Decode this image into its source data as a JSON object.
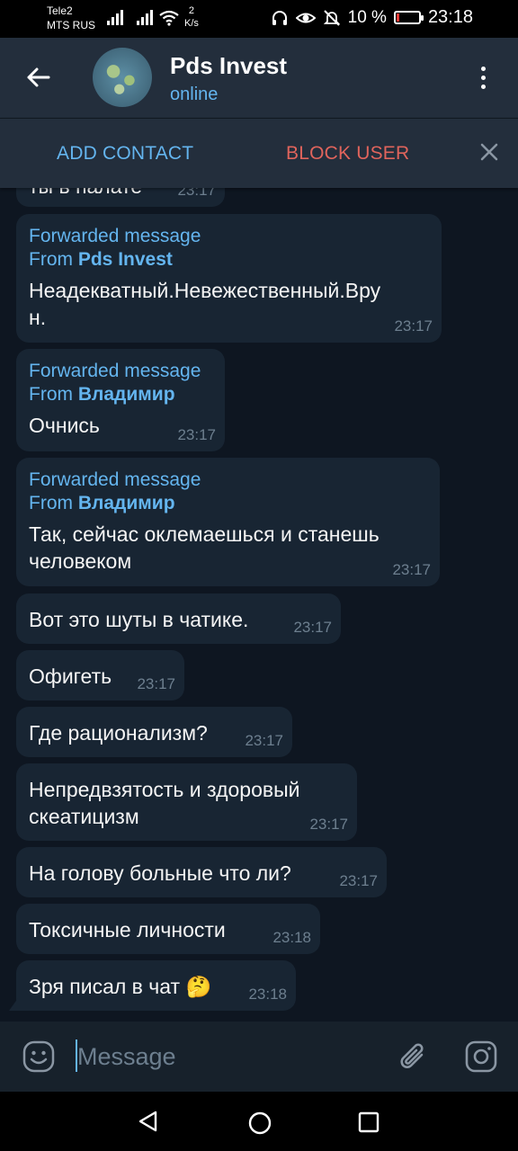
{
  "status_bar": {
    "carrier1": "Tele2",
    "carrier2": "MTS RUS",
    "speed_value": "2",
    "speed_unit": "K/s",
    "battery": "10 %",
    "battery_level": 0.1,
    "time": "23:18",
    "icons": [
      "headphones-icon",
      "eye-icon",
      "silent-icon",
      "battery-icon"
    ]
  },
  "header": {
    "back_icon": "arrow-left-icon",
    "title": "Pds Invest",
    "status": "online",
    "menu_icon": "more-vertical-icon"
  },
  "action_bar": {
    "add_contact": "ADD CONTACT",
    "block_user": "BLOCK USER",
    "close_icon": "close-icon"
  },
  "messages": [
    {
      "text": "ты в палате",
      "time": "23:17"
    },
    {
      "fwd_label": "Forwarded message",
      "fwd_from_prefix": "From",
      "fwd_from_name": "Pds Invest",
      "text": "Неадекватный.Невежественный.Вру",
      "text2": "н.",
      "time": "23:17"
    },
    {
      "fwd_label": "Forwarded message",
      "fwd_from_prefix": "From",
      "fwd_from_name": "Владимир",
      "text": "Очнись",
      "time": "23:17"
    },
    {
      "fwd_label": "Forwarded message",
      "fwd_from_prefix": "From",
      "fwd_from_name": "Владимир",
      "text": "Так, сейчас оклемаешься и станешь",
      "text2": "человеком",
      "time": "23:17"
    },
    {
      "text": "Вот это шуты в чатике.",
      "time": "23:17"
    },
    {
      "text": "Офигеть",
      "time": "23:17"
    },
    {
      "text": "Где рационализм?",
      "time": "23:17"
    },
    {
      "text": "Непредвзятость и здоровый",
      "text2": "скеатицизм",
      "time": "23:17"
    },
    {
      "text": "На голову больные что ли?",
      "time": "23:17"
    },
    {
      "text": "Токсичные личности",
      "time": "23:18"
    },
    {
      "text": "Зря писал в чат",
      "emoji": "🤔",
      "time": "23:18"
    }
  ],
  "input": {
    "placeholder": "Message",
    "emoji_icon": "smile-icon",
    "attach_icon": "paperclip-icon",
    "camera_icon": "camera-icon"
  },
  "nav_bar": {
    "icons": [
      "nav-back-icon",
      "nav-home-icon",
      "nav-recent-icon"
    ]
  },
  "colors": {
    "header_bg": "#232e3c",
    "chat_bg": "#0e1621",
    "bubble_bg": "#182533",
    "accent": "#64b5ef",
    "danger": "#e0645c"
  }
}
